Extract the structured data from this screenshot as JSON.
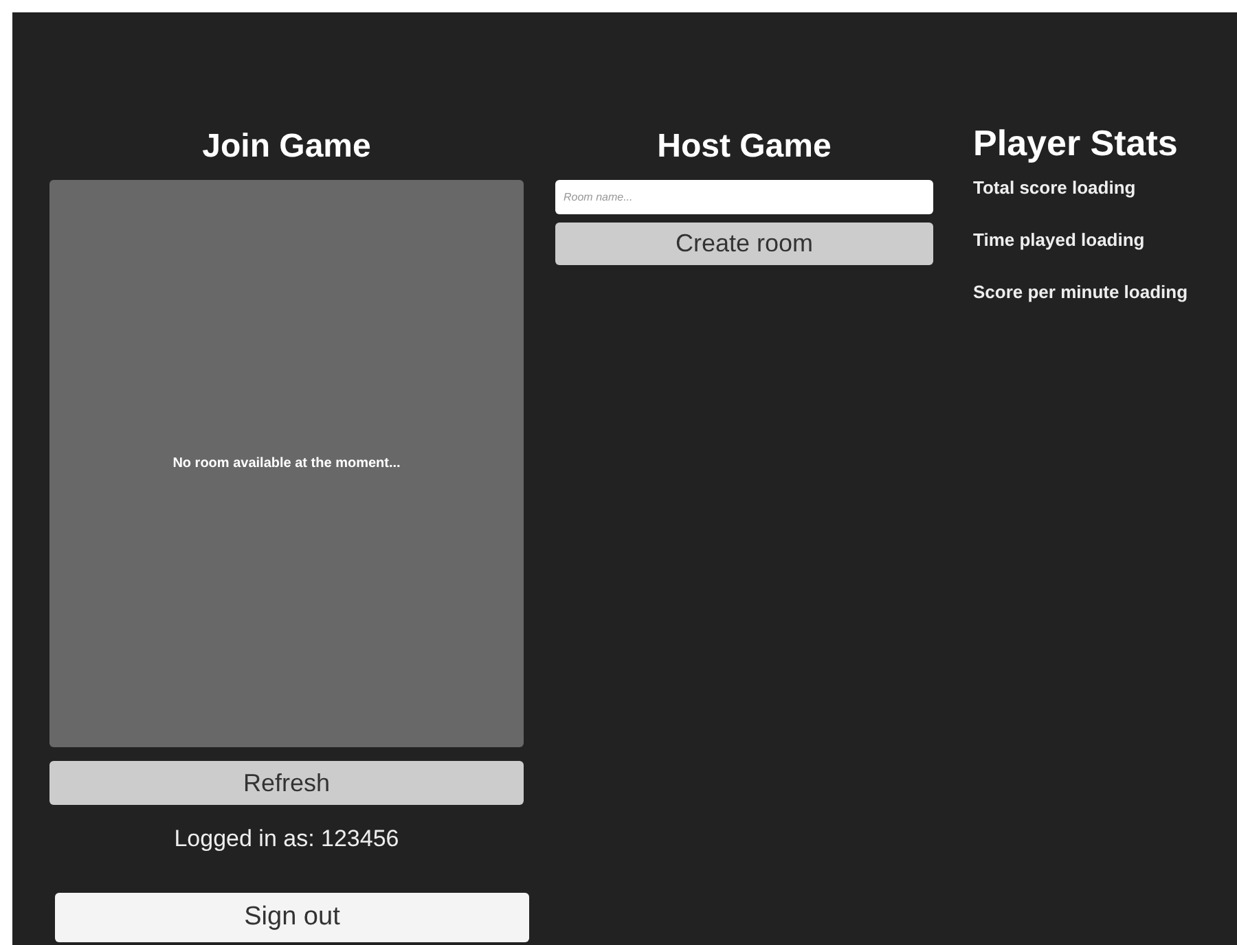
{
  "join_game": {
    "title": "Join Game",
    "room_list": {
      "empty_message": "No room available at the moment..."
    },
    "refresh_button": "Refresh",
    "logged_in": "Logged in as: 123456",
    "sign_out_button": "Sign out"
  },
  "host_game": {
    "title": "Host Game",
    "room_name": {
      "placeholder": "Room name..."
    },
    "create_button": "Create room"
  },
  "player_stats": {
    "title": "Player Stats",
    "stats": [
      "Total score loading",
      "Time played loading",
      "Score per minute loading"
    ]
  }
}
